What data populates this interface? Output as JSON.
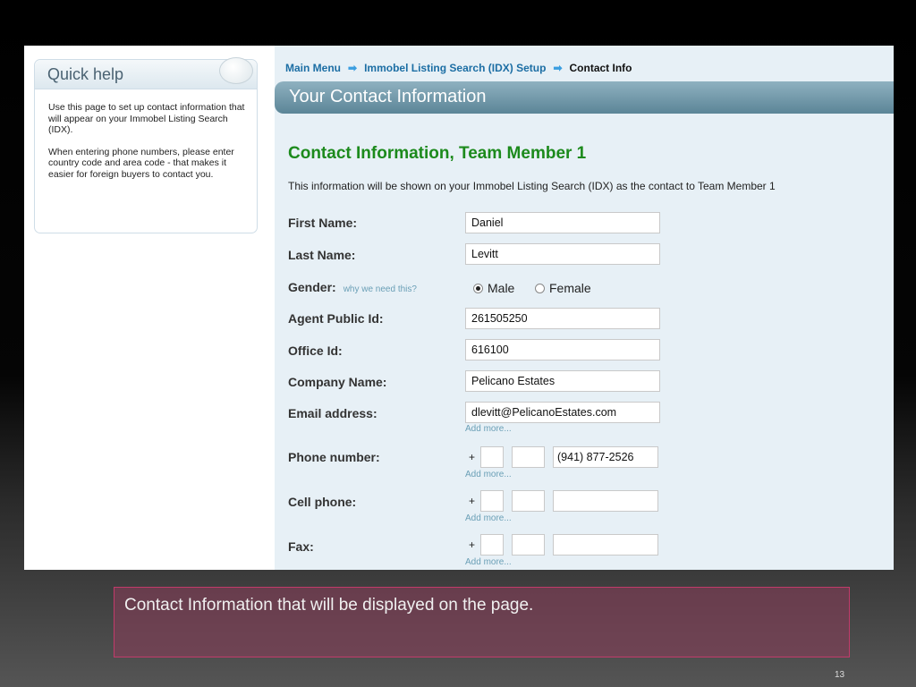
{
  "quick_help": {
    "title": "Quick help",
    "para1": "Use this page to set up contact information that will appear on your Immobel Listing Search (IDX).",
    "para2": "When entering phone numbers, please enter country code and area code - that makes it easier for foreign buyers to contact you."
  },
  "breadcrumb": {
    "item1": "Main Menu",
    "item2": "Immobel Listing Search (IDX) Setup",
    "current": "Contact Info",
    "arrow": "➡"
  },
  "page_title": "Your Contact Information",
  "section_title": "Contact Information, Team Member 1",
  "info_text": "This information will be shown on your Immobel Listing Search (IDX) as the contact to Team Member 1",
  "form": {
    "first_name": {
      "label": "First Name:",
      "value": "Daniel"
    },
    "last_name": {
      "label": "Last Name:",
      "value": "Levitt"
    },
    "gender": {
      "label": "Gender:",
      "why": "why we need this?",
      "male": "Male",
      "female": "Female",
      "selected": "Male"
    },
    "agent_id": {
      "label": "Agent Public Id:",
      "value": "261505250"
    },
    "office_id": {
      "label": "Office Id:",
      "value": "616100"
    },
    "company": {
      "label": "Company Name:",
      "value": "Pelicano Estates"
    },
    "email": {
      "label": "Email address:",
      "value": "dlevitt@PelicanoEstates.com",
      "add_more": "Add more..."
    },
    "phone": {
      "label": "Phone number:",
      "plus": "+",
      "country": "",
      "area": "",
      "number": "(941) 877-2526",
      "add_more": "Add more..."
    },
    "cell": {
      "label": "Cell phone:",
      "plus": "+",
      "country": "",
      "area": "",
      "number": "",
      "add_more": "Add more..."
    },
    "fax": {
      "label": "Fax:",
      "plus": "+",
      "country": "",
      "area": "",
      "number": "",
      "add_more": "Add more..."
    }
  },
  "caption": "Contact Information that will be displayed on the page.",
  "page_number": "13"
}
